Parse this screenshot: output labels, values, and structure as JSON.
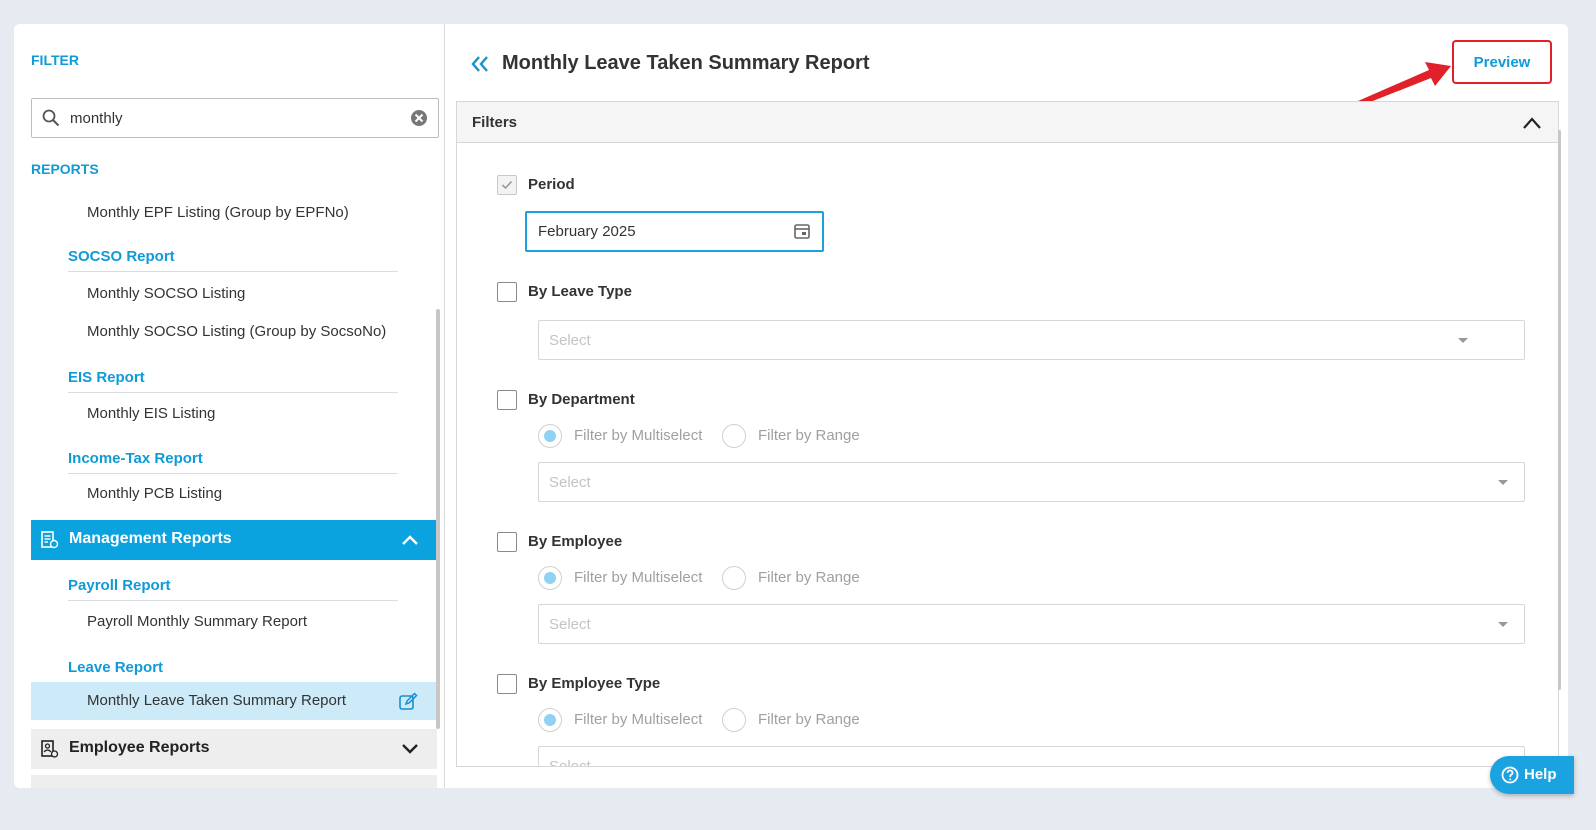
{
  "sidebar": {
    "filter_label": "FILTER",
    "search_value": "monthly",
    "reports_label": "REPORTS",
    "items": {
      "epf_group": "Monthly EPF Listing (Group by EPFNo)",
      "socso_group_title": "SOCSO Report",
      "socso_listing": "Monthly SOCSO Listing",
      "socso_group_listing": "Monthly SOCSO Listing (Group by SocsoNo)",
      "eis_group_title": "EIS Report",
      "eis_listing": "Monthly EIS Listing",
      "tax_group_title": "Income-Tax Report",
      "pcb_listing": "Monthly PCB Listing",
      "mgmt_title": "Management Reports",
      "payroll_group_title": "Payroll Report",
      "payroll_summary": "Payroll Monthly Summary Report",
      "leave_group_title": "Leave Report",
      "leave_summary": "Monthly Leave Taken Summary Report",
      "employee_reports": "Employee Reports"
    }
  },
  "main": {
    "title": "Monthly Leave Taken Summary Report",
    "preview_label": "Preview",
    "filters_label": "Filters",
    "period_label": "Period",
    "period_value": "February 2025",
    "by_leave_type_label": "By Leave Type",
    "by_department_label": "By Department",
    "by_employee_label": "By Employee",
    "by_employee_type_label": "By Employee Type",
    "select_placeholder": "Select",
    "radio_multiselect": "Filter by Multiselect",
    "radio_range": "Filter by Range"
  },
  "help_label": "Help",
  "colors": {
    "accent": "#0f9ad8",
    "header_active": "#0aa2df",
    "highlight_border": "#e0212a"
  }
}
